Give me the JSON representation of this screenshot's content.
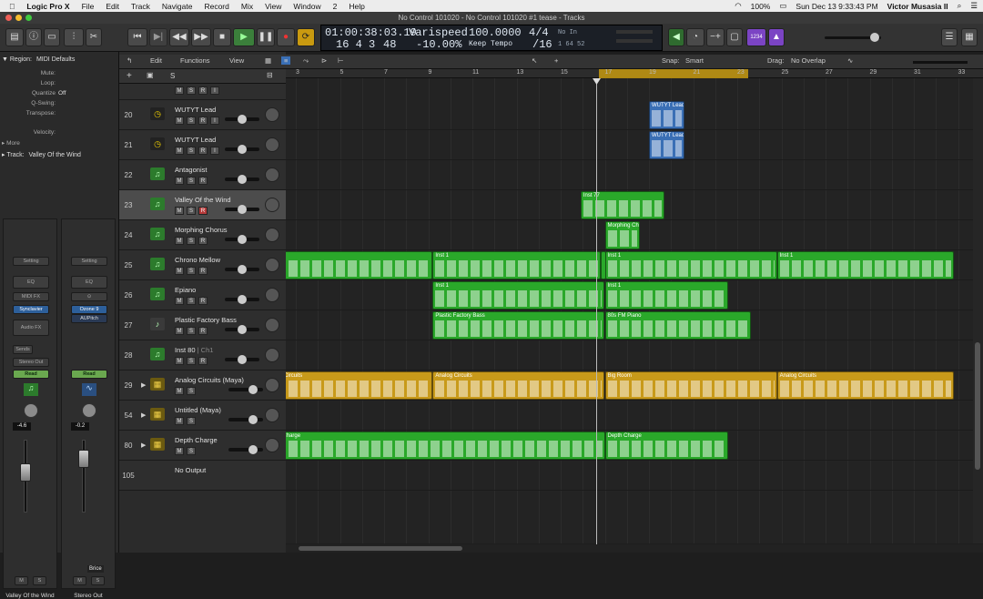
{
  "menubar": {
    "apple": "",
    "app": "Logic Pro X",
    "items": [
      "File",
      "Edit",
      "Track",
      "Navigate",
      "Record",
      "Mix",
      "View",
      "Window",
      "2",
      "Help"
    ],
    "battery": "100%",
    "datetime": "Sun Dec 13  9:33:43 PM",
    "user": "Victor Musasia II"
  },
  "window": {
    "title": "No Control 101020 - No Control 101020 #1 tease - Tracks"
  },
  "lcd": {
    "time": "01:00:38:03.19",
    "bars": "16  4  3",
    "ticks": "48",
    "mode_label": "Varispeed",
    "percent": "-10.00%",
    "tempo": "100.0000",
    "tempo_label": "Keep Tempo",
    "sig_top": "4/4",
    "sig_bottom": "/16",
    "midi_in": "No In",
    "midi_out": "1  64  52"
  },
  "controlbar": {
    "count_in": "1234"
  },
  "inspector": {
    "region_label": "Region:",
    "region_name": "MIDI Defaults",
    "rows": [
      {
        "k": "Mute:",
        "v": ""
      },
      {
        "k": "Loop:",
        "v": ""
      },
      {
        "k": "Quantize",
        "v": "Off"
      },
      {
        "k": "Q-Swing:",
        "v": ""
      },
      {
        "k": "Transpose:",
        "v": ""
      },
      {
        "k": "Velocity:",
        "v": ""
      }
    ],
    "more": "More",
    "track_label": "Track:",
    "track_name": "Valley Of the Wind",
    "strip1": {
      "setting": "Setting",
      "eq": "EQ",
      "midifx": "MIDI FX",
      "inst": "Synclavier",
      "audiofx": "Audio FX",
      "sends": "Sends",
      "output": "Stereo Out",
      "read": "Read",
      "vol": "-4.6",
      "m": "M",
      "s": "S",
      "name": "Valley Of the Wind"
    },
    "strip2": {
      "setting": "Setting",
      "eq": "EQ",
      "plug1": "Ozone 9",
      "plug2": "AUPitch",
      "read": "Read",
      "vol": "-0.2",
      "m": "M",
      "s": "S",
      "name": "Stereo Out",
      "tooltip": "Brice"
    }
  },
  "toolbar2": {
    "edit": "Edit",
    "functions": "Functions",
    "view": "View",
    "snap_label": "Snap:",
    "snap": "Smart",
    "drag_label": "Drag:",
    "drag": "No Overlap"
  },
  "ruler": [
    "3",
    "5",
    "7",
    "9",
    "11",
    "13",
    "15",
    "17",
    "19",
    "21",
    "23",
    "25",
    "27",
    "29",
    "31",
    "33"
  ],
  "tracks": [
    {
      "num": "20",
      "name": "WUTYT Lead",
      "icon": "clock-icon",
      "sel": false
    },
    {
      "num": "21",
      "name": "WUTYT Lead",
      "icon": "clock-icon",
      "sel": false
    },
    {
      "num": "22",
      "name": "Antagonist",
      "icon": "music-note-icon",
      "sel": false
    },
    {
      "num": "23",
      "name": "Valley Of the Wind",
      "icon": "music-note-icon",
      "sel": true
    },
    {
      "num": "24",
      "name": "Morphing Chorus",
      "icon": "music-note-icon",
      "sel": false
    },
    {
      "num": "25",
      "name": "Chrono Mellow",
      "icon": "music-note-icon",
      "sel": false
    },
    {
      "num": "26",
      "name": "Epiano",
      "icon": "music-note-icon",
      "sel": false
    },
    {
      "num": "27",
      "name": "Plastic Factory Bass",
      "icon": "guitar-icon",
      "sel": false
    },
    {
      "num": "28",
      "name": "Inst 80",
      "sub": "Ch1",
      "icon": "music-note-icon",
      "sel": false
    },
    {
      "num": "29",
      "name": "Analog Circuits (Maya)",
      "icon": "drum-machine-icon",
      "sel": false
    },
    {
      "num": "54",
      "name": "Untitled (Maya)",
      "icon": "drum-machine-icon",
      "sel": false
    },
    {
      "num": "80",
      "name": "Depth Charge",
      "icon": "drum-machine-icon",
      "sel": false
    },
    {
      "num": "105",
      "name": "No Output",
      "icon": "",
      "sel": false
    }
  ],
  "regions": [
    {
      "lane": 0,
      "x": 16.0,
      "w": 1.6,
      "name": "WUTYT Lead",
      "color": "blue"
    },
    {
      "lane": 1,
      "x": 16.0,
      "w": 1.6,
      "name": "WUTYT Lead",
      "color": "blue"
    },
    {
      "lane": 3,
      "x": 12.9,
      "w": 3.8,
      "name": "Inst 77",
      "color": "green"
    },
    {
      "lane": 4,
      "x": 14.0,
      "w": 1.6,
      "name": "Morphing Ch",
      "color": "green"
    },
    {
      "lane": 5,
      "x": -1.0,
      "w": 7.2,
      "name": "1",
      "color": "green"
    },
    {
      "lane": 5,
      "x": 6.2,
      "w": 7.6,
      "name": "Inst 1",
      "color": "green"
    },
    {
      "lane": 5,
      "x": 13.8,
      "w": 0.1,
      "name": "",
      "color": "green"
    },
    {
      "lane": 5,
      "x": 14.0,
      "w": 7.8,
      "name": "Inst 1",
      "color": "green"
    },
    {
      "lane": 5,
      "x": 21.8,
      "w": 8.0,
      "name": "Inst 1",
      "color": "green"
    },
    {
      "lane": 6,
      "x": 6.2,
      "w": 7.8,
      "name": "Inst 1",
      "color": "green"
    },
    {
      "lane": 6,
      "x": 14.0,
      "w": 5.6,
      "name": "Inst 1",
      "color": "green"
    },
    {
      "lane": 7,
      "x": 6.2,
      "w": 7.8,
      "name": "Plastic Factory Bass",
      "color": "green"
    },
    {
      "lane": 7,
      "x": 14.0,
      "w": 6.6,
      "name": "80s FM Piano",
      "color": "green"
    },
    {
      "lane": 9,
      "x": -1.0,
      "w": 7.2,
      "name": "og Circuits",
      "color": "yellow"
    },
    {
      "lane": 9,
      "x": 6.2,
      "w": 7.8,
      "name": "Analog Circuits",
      "color": "yellow"
    },
    {
      "lane": 9,
      "x": 14.0,
      "w": 7.8,
      "name": "Big Room",
      "color": "yellow"
    },
    {
      "lane": 9,
      "x": 21.8,
      "w": 8.0,
      "name": "Analog Circuits",
      "color": "yellow"
    },
    {
      "lane": 11,
      "x": -1.0,
      "w": 15.0,
      "name": "th Charge",
      "color": "green"
    },
    {
      "lane": 11,
      "x": 14.0,
      "w": 5.6,
      "name": "Depth Charge",
      "color": "green"
    }
  ],
  "colors": {
    "green": "#2aa82a",
    "yellow": "#c89a1a",
    "blue": "#3a6fb5"
  }
}
